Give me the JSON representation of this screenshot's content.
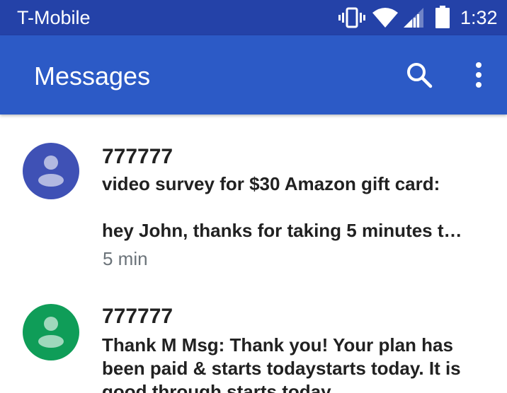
{
  "status_bar": {
    "carrier": "T-Mobile",
    "time": "1:32",
    "icons": [
      "vibrate-icon",
      "wifi-icon",
      "cell-signal-icon",
      "battery-icon"
    ]
  },
  "app_bar": {
    "title": "Messages",
    "icons": [
      "search-icon",
      "more-vert-icon"
    ]
  },
  "conversations": [
    {
      "sender": "777777",
      "snippet": "video survey for $30 Amazon gift card:\n\nhey John, thanks for taking 5 minutes t…",
      "time": "5 min",
      "avatar_color": "#3f51b5"
    },
    {
      "sender": "777777",
      "snippet": "Thank M Msg: Thank you! Your  plan has been paid & starts todaystarts today. It is good through starts today",
      "avatar_color": "#0f9d58"
    }
  ],
  "colors": {
    "status_bar": "#2442a8",
    "app_bar": "#2c5ac6",
    "sender_text": "#212121",
    "time_text": "#6b7379"
  }
}
